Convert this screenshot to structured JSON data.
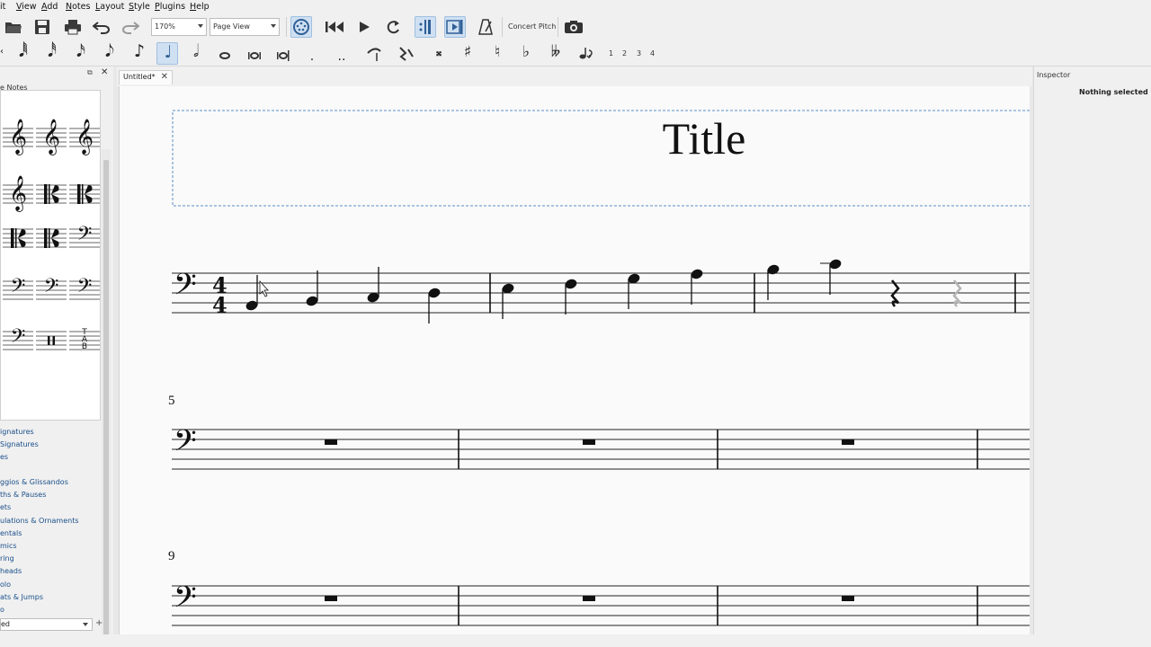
{
  "menubar": {
    "items": [
      {
        "label": "it",
        "u": ""
      },
      {
        "label": "iew",
        "u": "V"
      },
      {
        "label": "dd",
        "u": "A"
      },
      {
        "label": "otes",
        "u": "N"
      },
      {
        "label": "ayout",
        "u": "L"
      },
      {
        "label": "tyle",
        "u": "S"
      },
      {
        "label": "lugins",
        "u": "P"
      },
      {
        "label": "elp",
        "u": "H"
      }
    ]
  },
  "toolbar": {
    "zoom": "170%",
    "view_mode": "Page View",
    "concert_pitch": "Concert Pitch",
    "voices": [
      "1",
      "2",
      "3",
      "4"
    ]
  },
  "palette": {
    "title": "e Notes",
    "list": [
      "ignatures",
      "Signatures",
      "es",
      "ggios & Glissandos",
      "ths & Pauses",
      "ets",
      "ulations & Ornaments",
      "entals",
      "mics",
      "ring",
      "heads",
      "olo",
      "ats & Jumps",
      "o"
    ],
    "workspace": "ed",
    "add": "+"
  },
  "tab": {
    "label": "Untitled*",
    "close": "✕"
  },
  "score": {
    "title": "Title",
    "system2_measure": "5",
    "system3_measure": "9"
  },
  "inspector": {
    "title": "Inspector",
    "message": "Nothing selected"
  }
}
